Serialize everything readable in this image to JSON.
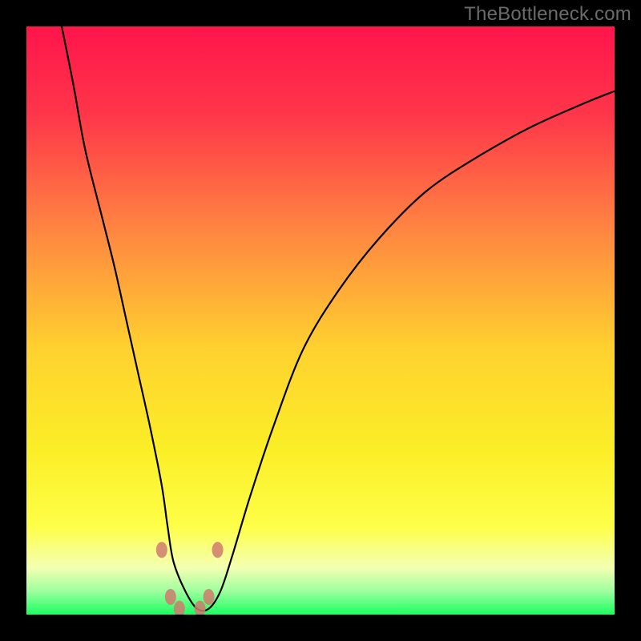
{
  "watermark": "TheBottleneck.com",
  "chart_data": {
    "type": "line",
    "title": "",
    "xlabel": "",
    "ylabel": "",
    "xlim": [
      0,
      100
    ],
    "ylim": [
      0,
      100
    ],
    "gradient_stops": [
      {
        "offset": 0.0,
        "color": "#ff154b"
      },
      {
        "offset": 0.15,
        "color": "#ff364a"
      },
      {
        "offset": 0.35,
        "color": "#ff8741"
      },
      {
        "offset": 0.55,
        "color": "#ffd22f"
      },
      {
        "offset": 0.72,
        "color": "#fbee27"
      },
      {
        "offset": 0.85,
        "color": "#feff48"
      },
      {
        "offset": 0.92,
        "color": "#f4ffb2"
      },
      {
        "offset": 0.96,
        "color": "#9eff9e"
      },
      {
        "offset": 1.0,
        "color": "#1bff61"
      }
    ],
    "series": [
      {
        "name": "bottleneck-curve",
        "color": "#000000",
        "x": [
          6,
          8,
          10,
          13,
          15,
          17,
          19,
          21,
          23,
          24,
          25,
          27,
          29,
          31,
          33,
          35,
          38,
          42,
          47,
          53,
          60,
          68,
          77,
          86,
          95,
          100
        ],
        "values": [
          100,
          90,
          79,
          67,
          59,
          50,
          41,
          32,
          22,
          15,
          9,
          4,
          1,
          1,
          4,
          10,
          20,
          32,
          45,
          55,
          64,
          72,
          78,
          83,
          87,
          89
        ]
      }
    ],
    "markers": [
      {
        "x": 23.0,
        "y": 11.0
      },
      {
        "x": 24.5,
        "y": 3.0
      },
      {
        "x": 26.0,
        "y": 1.0
      },
      {
        "x": 29.5,
        "y": 1.0
      },
      {
        "x": 31.0,
        "y": 3.0
      },
      {
        "x": 32.5,
        "y": 11.0
      }
    ],
    "marker_style": {
      "color": "#cf7b6f",
      "rx": 7,
      "ry": 10
    }
  }
}
